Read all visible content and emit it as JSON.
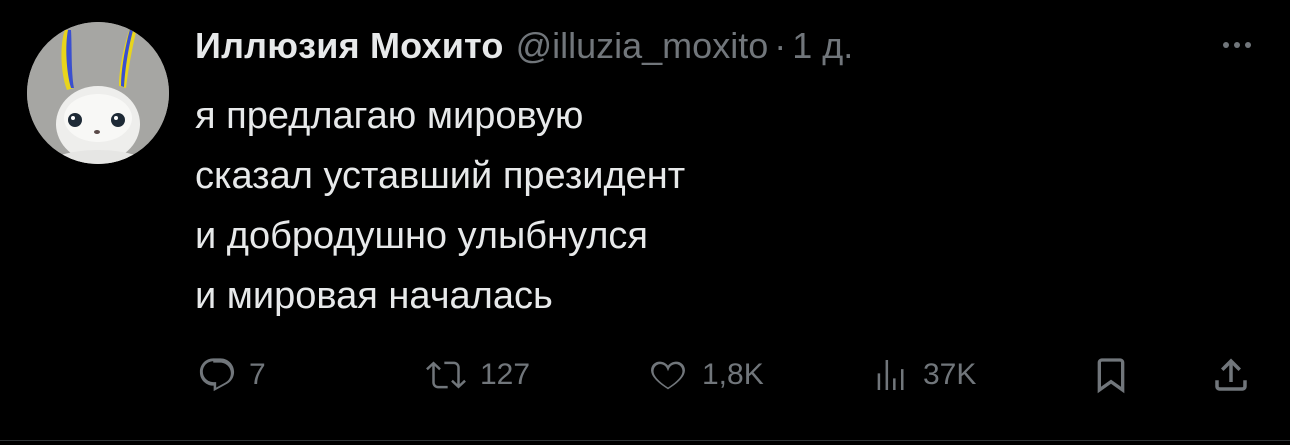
{
  "tweet": {
    "author": {
      "display_name": "Иллюзия Мохито",
      "handle": "@illuzia_moxito",
      "avatar_icon": "white-bunny-avatar"
    },
    "separator": "·",
    "time": "1 д.",
    "more_icon": "more-horizontal-icon",
    "lines": [
      "я предлагаю мировую",
      "сказал уставший президент",
      "и добродушно улыбнулся",
      "и мировая началась"
    ],
    "actions": {
      "reply": {
        "icon": "reply-icon",
        "count": "7"
      },
      "retweet": {
        "icon": "retweet-icon",
        "count": "127"
      },
      "like": {
        "icon": "heart-icon",
        "count": "1,8K"
      },
      "views": {
        "icon": "views-chart-icon",
        "count": "37K"
      },
      "bookmark": {
        "icon": "bookmark-icon"
      },
      "share": {
        "icon": "share-icon"
      }
    }
  },
  "colors": {
    "background": "#000000",
    "text_primary": "#e7e9ea",
    "text_secondary": "#71767b",
    "divider": "#2f3336",
    "avatar_ears_yellow": "#e8d51c",
    "avatar_ears_blue": "#3a4fd0"
  }
}
